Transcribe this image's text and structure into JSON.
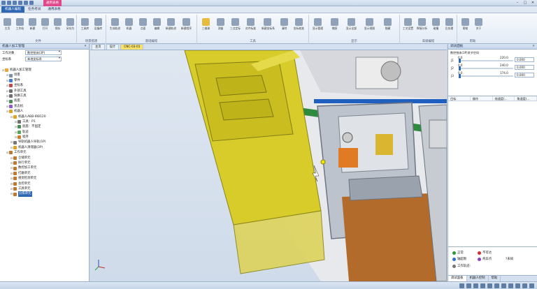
{
  "app": {
    "context_tab": "通用表格",
    "tabs": [
      "机器人编程",
      "任务考试",
      "通用表格"
    ],
    "active_tab": 0
  },
  "ribbon": {
    "groups": [
      {
        "title": "文件",
        "buttons": [
          "主页",
          "工作站",
          "新建",
          "打开",
          "保存",
          "另存为"
        ]
      },
      {
        "title": "场景搭建",
        "buttons": [
          "工具库",
          "设备库"
        ]
      },
      {
        "title": "基础编程",
        "buttons": [
          "生成轨迹",
          "机器",
          "点面",
          "编辑",
          "新建轨迹",
          "新建程序"
        ]
      },
      {
        "title": "工具",
        "buttons": [
          "三维球",
          "测量",
          "三点定标",
          "对齐标准",
          "新建坐标系",
          "清除",
          "坐标校准"
        ]
      },
      {
        "title": "显示",
        "buttons": [
          "显示管理",
          "捕捉",
          "显示全部",
          "显示视图",
          "隐藏"
        ]
      },
      {
        "title": "高级编程",
        "buttons": [
          "工艺设置",
          "焊接分析",
          "碰撞",
          "后处理"
        ]
      },
      {
        "title": "帮助",
        "buttons": [
          "帮助",
          "关于"
        ]
      }
    ]
  },
  "left_panel": {
    "title": "机器人加工管理",
    "fields": [
      {
        "key": "工作对象",
        "value": "数控铣床(3P)"
      },
      {
        "key": "坐标系",
        "value": "本地坐标系"
      }
    ],
    "tree": [
      {
        "label": "机器人加工管理",
        "level": 0,
        "icon": "folder"
      },
      {
        "label": "场景",
        "level": 1,
        "icon": "gear"
      },
      {
        "label": "零件",
        "level": 1,
        "icon": "part"
      },
      {
        "label": "坐标系",
        "level": 1,
        "icon": "axes"
      },
      {
        "label": "外部工具",
        "level": 1,
        "icon": "tool"
      },
      {
        "label": "快换工具",
        "level": 1,
        "icon": "tool"
      },
      {
        "label": "底座",
        "level": 1,
        "icon": "base"
      },
      {
        "label": "状态机",
        "level": 1,
        "icon": "state"
      },
      {
        "label": "机器人",
        "level": 1,
        "icon": "robot"
      },
      {
        "label": "机器人ABB-IRB120",
        "level": 2,
        "icon": "robot"
      },
      {
        "label": "工具：P1",
        "level": 3,
        "icon": "tool"
      },
      {
        "label": "底座：不固定",
        "level": 3,
        "icon": "base"
      },
      {
        "label": "轨迹",
        "level": 3,
        "icon": "path"
      },
      {
        "label": "程序",
        "level": 3,
        "icon": "program"
      },
      {
        "label": "导轨机器人导轨(1P)",
        "level": 2,
        "icon": "rail"
      },
      {
        "label": "机器人清理器(3P)",
        "level": 2,
        "icon": "robot"
      },
      {
        "label": "工作单元",
        "level": 1,
        "icon": "unit"
      },
      {
        "label": "仓储单元",
        "level": 2,
        "icon": "unit"
      },
      {
        "label": "执行单元",
        "level": 2,
        "icon": "unit"
      },
      {
        "label": "数控加工单元",
        "level": 2,
        "icon": "unit"
      },
      {
        "label": "打磨单元",
        "level": 2,
        "icon": "unit"
      },
      {
        "label": "视觉检测单元",
        "level": 2,
        "icon": "unit"
      },
      {
        "label": "总控单元",
        "level": 2,
        "icon": "unit"
      },
      {
        "label": "工具单元",
        "level": 2,
        "icon": "unit"
      },
      {
        "label": "分拣单元",
        "level": 2,
        "icon": "unit"
      }
    ],
    "selected_index": 24
  },
  "doc_tabs": [
    "主页",
    "设计",
    "CNC-03-01"
  ],
  "active_doc_tab": 2,
  "right_panel": {
    "title": "调试面板",
    "joint_title": "数控铣床(3P)关节空间",
    "joints": [
      {
        "name": "J1",
        "min": "0.0",
        "max": "220.0",
        "value": "0.000",
        "level": 0.0
      },
      {
        "name": "J2",
        "min": "0.0",
        "max": "240.0",
        "value": "0.000",
        "level": 0.0
      },
      {
        "name": "J3",
        "min": "0.0",
        "max": "174.0",
        "value": "0.000",
        "level": 0.0
      }
    ],
    "grid_headers": [
      "目标",
      "操作",
      "线速度(...",
      "角速度(..."
    ],
    "status": {
      "normal": "正常",
      "unreachable": "不可达",
      "axis_limit": "轴超限",
      "singular": "奇异点",
      "unknown": "?未知",
      "work_path": "工作轨迹:"
    },
    "tabs": [
      "调试面板",
      "机器人控制",
      "帮助"
    ],
    "active_tab": 0
  }
}
